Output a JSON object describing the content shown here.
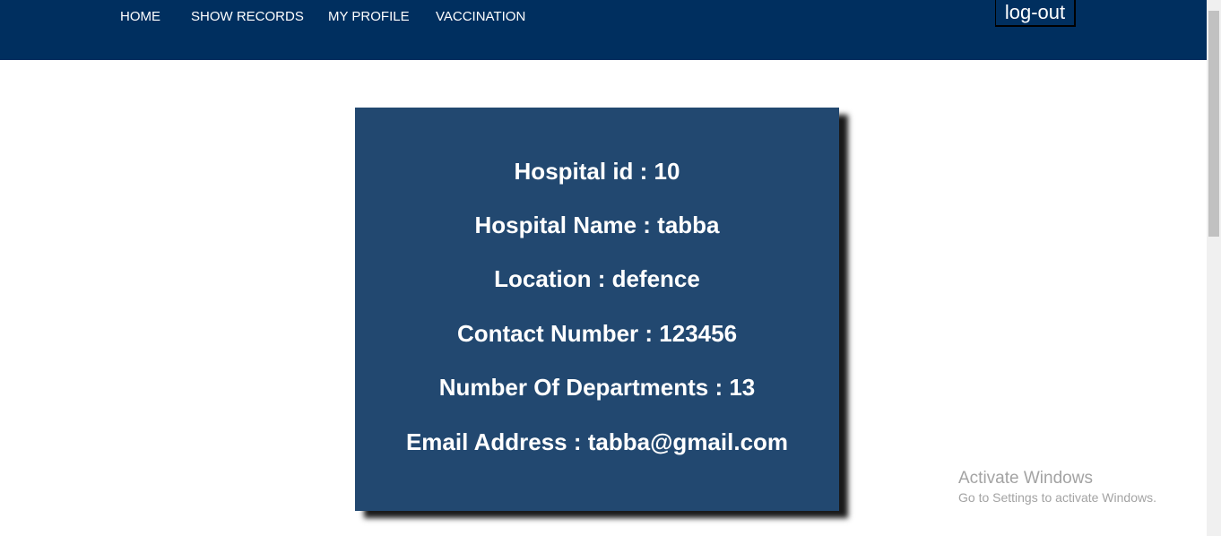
{
  "nav": {
    "items": [
      {
        "label": "HOME"
      },
      {
        "label": "SHOW RECORDS"
      },
      {
        "label": "MY PROFILE"
      },
      {
        "label": "VACCINATION"
      }
    ],
    "logout_label": "log-out"
  },
  "profile": {
    "hospital_id": "Hospital id : 10",
    "hospital_name": "Hospital Name : tabba",
    "location": "Location : defence",
    "contact_number": "Contact Number : 123456",
    "departments": "Number Of Departments : 13",
    "email": "Email Address : tabba@gmail.com"
  },
  "watermark": {
    "title": "Activate Windows",
    "subtitle": "Go to Settings to activate Windows."
  },
  "colors": {
    "navbar": "#002f5f",
    "card": "#224870",
    "text": "#ffffff",
    "watermark": "#a3a3a3"
  }
}
